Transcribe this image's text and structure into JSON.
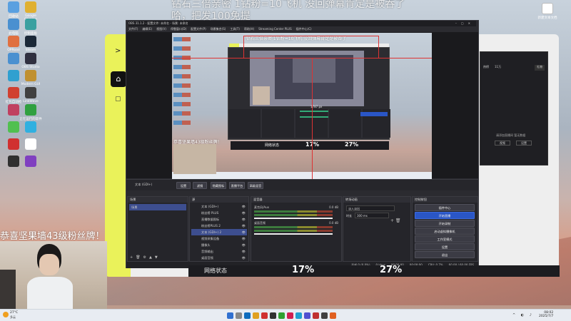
{
  "overlay": {
    "top_line1": "钻石三倍亲密 1钻粉=10飞机 没回弹幕肯定是被吞了",
    "top_line2": "哈，把发100免提",
    "left_banner": "恭喜坚果墙43级粉丝牌！",
    "inner_banner": "钻石三倍亲密 1钻粉=10飞机 没回弹幕肯定是被吞了",
    "inner_left_banner": "恭喜坚果墙43级粉丝牌！",
    "net_label": "网络状态",
    "stat1": "17%",
    "stat2": "27%"
  },
  "desktop_icons": [
    {
      "label": "回收站",
      "color": "#5aa0e0"
    },
    {
      "label": "Google Chrome",
      "color": "#e0b030"
    },
    {
      "label": "此电脑",
      "color": "#4a90d0"
    },
    {
      "label": "控制面板",
      "color": "#3aa0a0"
    },
    {
      "label": "OPRoad",
      "color": "#e07040"
    },
    {
      "label": "Steam",
      "color": "#1b2838"
    },
    {
      "label": "",
      "color": "#4a90d0"
    },
    {
      "label": "OBS Studio",
      "color": "#303040"
    },
    {
      "label": "",
      "color": "#30a0d0"
    },
    {
      "label": "Modern GUI",
      "color": "#c09030"
    },
    {
      "label": "红包自动抢",
      "color": "#d04030"
    },
    {
      "label": "LinkWave",
      "color": "#404040"
    },
    {
      "label": "",
      "color": "#c04060"
    },
    {
      "label": "正在运行的软件",
      "color": "#30a040"
    },
    {
      "label": "",
      "color": "#50c050"
    },
    {
      "label": "",
      "color": "#30b0e0"
    },
    {
      "label": "",
      "color": "#d03030"
    },
    {
      "label": "",
      "color": "#ffffff"
    },
    {
      "label": "",
      "color": "#303030"
    },
    {
      "label": "",
      "color": "#8040c0"
    }
  ],
  "right_icon_label": "新建文本文档",
  "obs": {
    "title": "OBS 31.1.2 - 配置文件: 未命名 - 场景: 未命名",
    "menu": [
      "文件(F)",
      "编辑(E)",
      "视图(V)",
      "停靠窗口(D)",
      "配置文件(P)",
      "场景集合(S)",
      "工具(T)",
      "帮助(H)",
      "Streaming Center PLUS",
      "插件中心(C)"
    ],
    "preview_toolbar": {
      "source_label": "文本 (GDI+)",
      "props": "设置",
      "filters": "滤镜",
      "transform": "隐藏图标",
      "stream": "直播平台",
      "more": "高级混音"
    },
    "scenes_title": "场景",
    "scene_items": [
      "场景"
    ],
    "sources_title": "源",
    "source_items": [
      "文本 (GDI+)",
      "粉丝榜 PLUS",
      "直播数据图标",
      "粉丝榜PLUS 2",
      "文本 (GDI+) 2",
      "视频采集设备",
      "摄像头",
      "音频输出",
      "桌面音频"
    ],
    "mixer_title": "混音器",
    "mixer_tracks": [
      {
        "name": "麦克风/Aux",
        "db": "0.0 dB"
      },
      {
        "name": "桌面音频",
        "db": "0.0 dB"
      }
    ],
    "transitions_title": "转场动画",
    "transition_type": "淡入淡出",
    "duration_label": "时长",
    "duration_value": "300 ms",
    "controls_title": "控制按钮",
    "controls": [
      "插件中心",
      "开始直播",
      "开始录制",
      "启动虚拟摄像机",
      "工作室模式",
      "设置",
      "退出"
    ],
    "status": [
      "丢帧 0 (0.0%)",
      "0 kbps",
      "00:00:00",
      "00:00:00",
      "CPU: 0.7%",
      "60.00 / 60.00 FPS"
    ]
  },
  "inner_obs": {
    "net_label": "网络状态",
    "stat1": "17%",
    "stat2": "27%",
    "fps_label": "1787 px"
  },
  "right_panel": {
    "tabs": [
      "热榜",
      "11万",
      "礼物"
    ],
    "btn1": "视频",
    "btn2": "设置",
    "text": "请添加直播间 暂无数据"
  },
  "taskbar": {
    "weather": "27°C",
    "weather_sub": "多云",
    "time": "08:02",
    "date": "2025/7/7",
    "icons": [
      "#3070d0",
      "#888",
      "#0f6cbd",
      "#e0a020",
      "#d03030",
      "#303030",
      "#30a030",
      "#d02050",
      "#20a0d0",
      "#5050d0",
      "#c03030",
      "#404040",
      "#e06020"
    ]
  },
  "sidebar_app": {
    "chevron": ">",
    "home": "⌂",
    "cube": "▢"
  }
}
